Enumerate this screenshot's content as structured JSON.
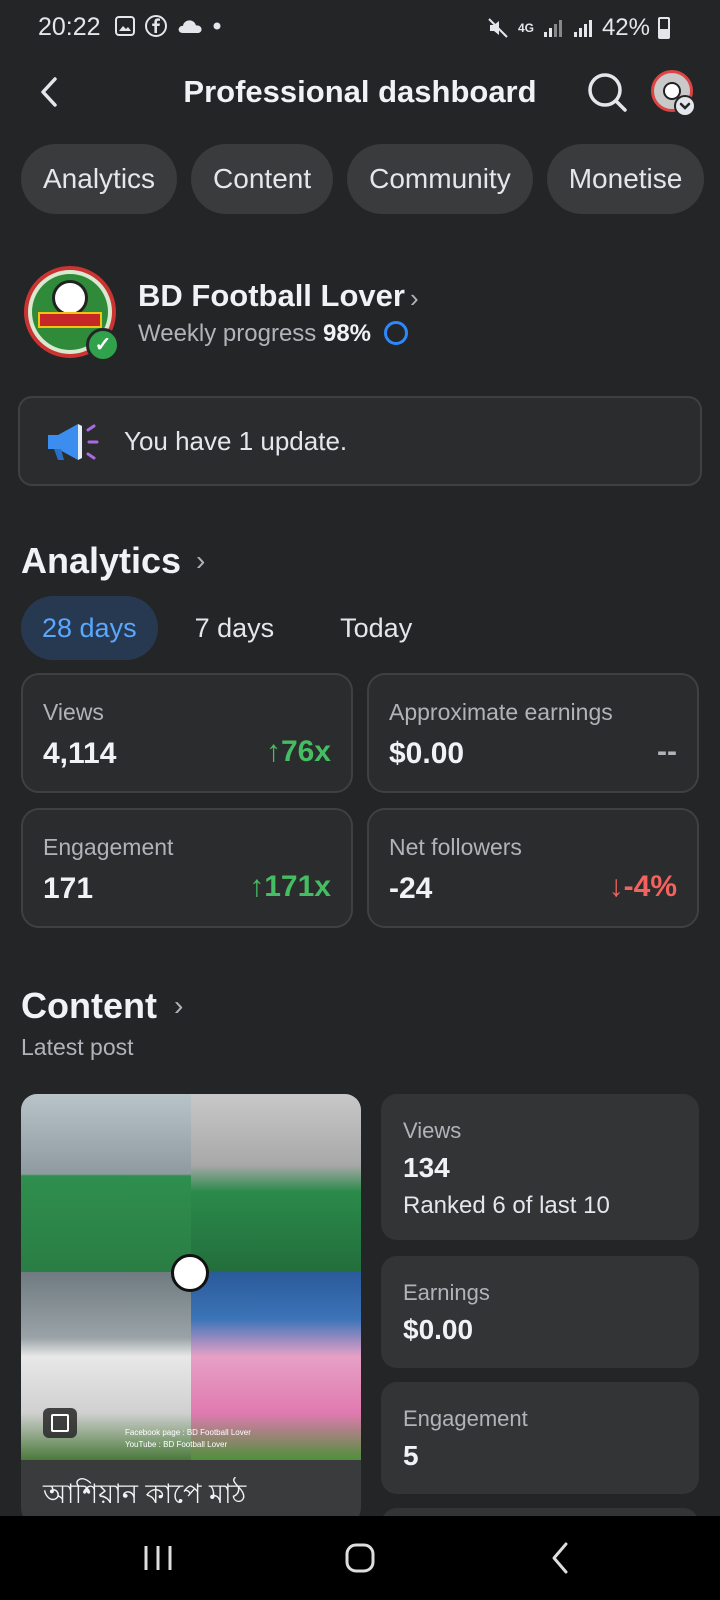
{
  "status_bar": {
    "time": "20:22",
    "battery": "42%",
    "network": "4G"
  },
  "header": {
    "title": "Professional dashboard"
  },
  "tabs": [
    "Analytics",
    "Content",
    "Community",
    "Monetise"
  ],
  "profile": {
    "name": "BD Football Lover",
    "progress_label": "Weekly progress",
    "progress_value": "98%"
  },
  "update": {
    "text": "You have 1 update."
  },
  "analytics": {
    "title": "Analytics",
    "ranges": [
      "28 days",
      "7 days",
      "Today"
    ],
    "selected_range": "28 days",
    "metrics": [
      {
        "label": "Views",
        "value": "4,114",
        "change": "↑76x",
        "trend": "up"
      },
      {
        "label": "Approximate earnings",
        "value": "$0.00",
        "change": "--",
        "trend": "neutral"
      },
      {
        "label": "Engagement",
        "value": "171",
        "change": "↑171x",
        "trend": "up"
      },
      {
        "label": "Net followers",
        "value": "-24",
        "change": "↓-4%",
        "trend": "down"
      }
    ]
  },
  "content": {
    "title": "Content",
    "subtitle": "Latest post",
    "post": {
      "caption": "আশিয়ান কাপে মাঠ",
      "image_facebook_text": "Facebook page : BD Football Lover",
      "image_youtube_text": "YouTube : BD Football Lover"
    },
    "stats": [
      {
        "label": "Views",
        "value": "134",
        "sub": "Ranked 6 of last 10"
      },
      {
        "label": "Earnings",
        "value": "$0.00"
      },
      {
        "label": "Engagement",
        "value": "5"
      }
    ]
  },
  "colors": {
    "background": "#242527",
    "accent_blue": "#2d88ff",
    "positive_green": "#45bd62",
    "negative_red": "#f3625c"
  }
}
